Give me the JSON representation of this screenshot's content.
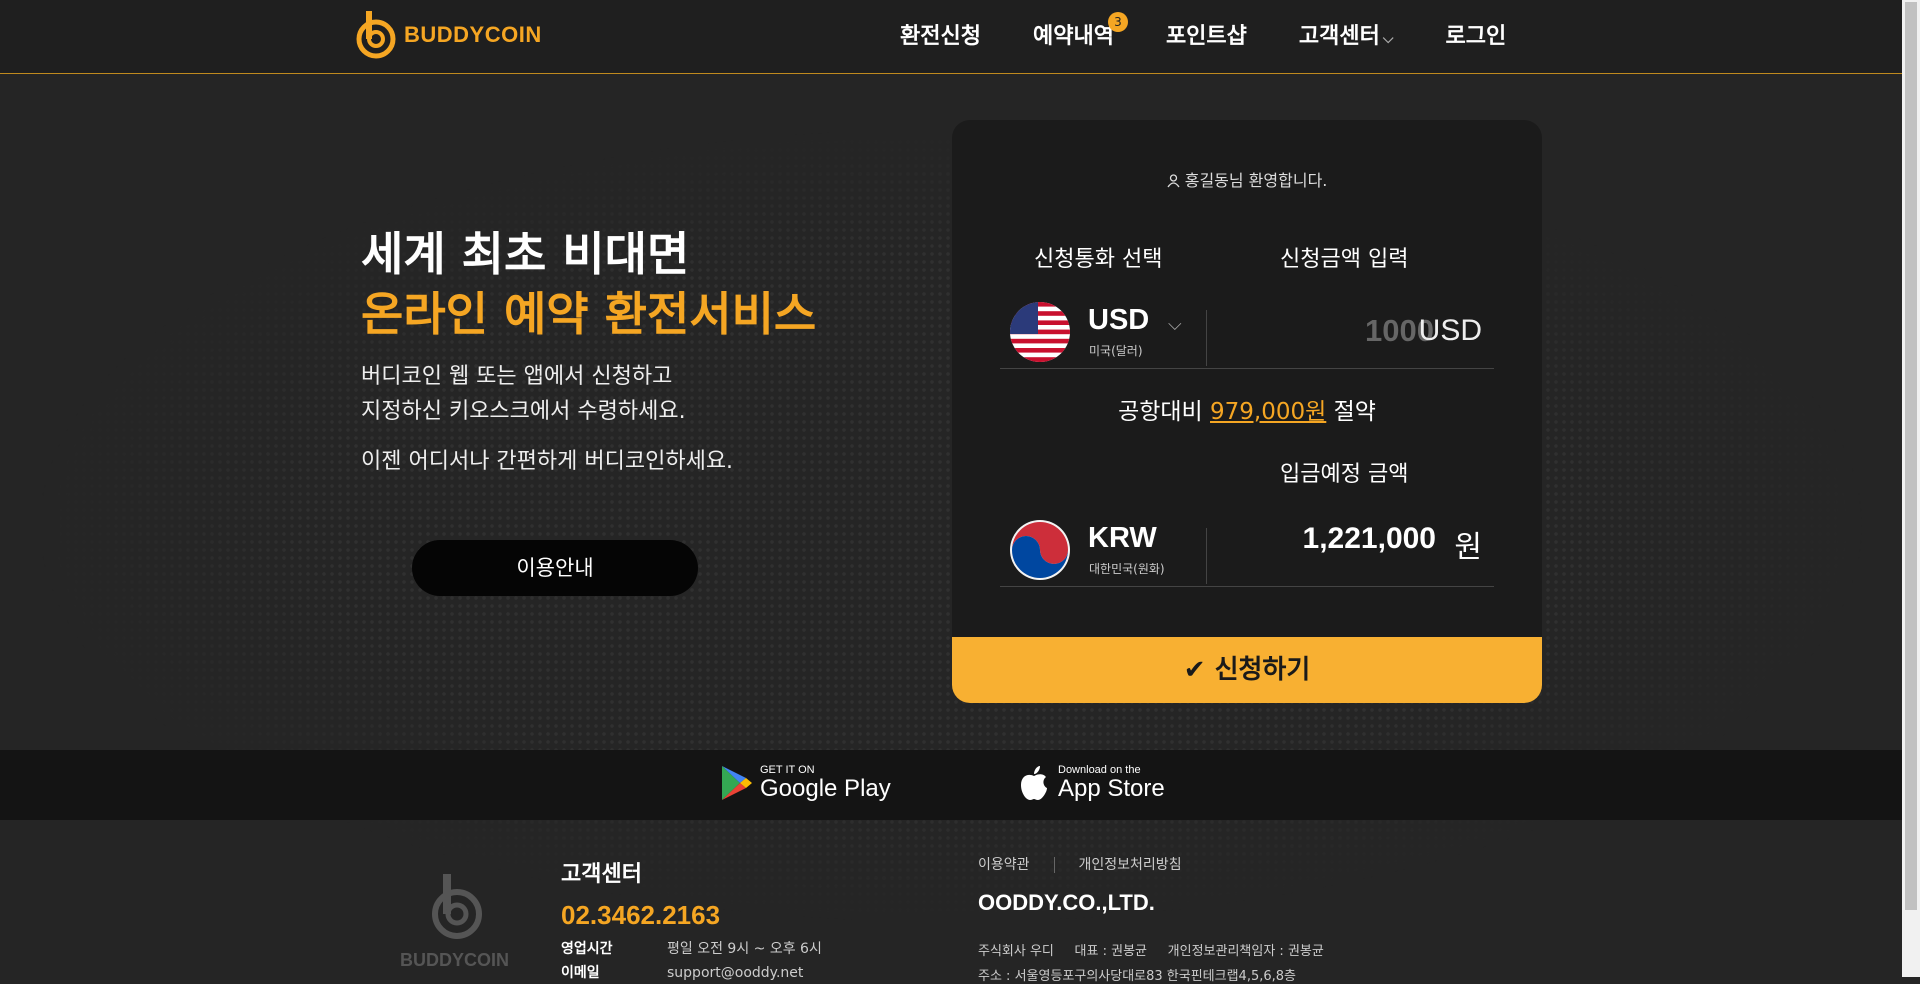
{
  "header": {
    "brand": "BUDDYCOIN",
    "nav": [
      {
        "label": "환전신청"
      },
      {
        "label": "예약내역",
        "badge": "3"
      },
      {
        "label": "포인트샵"
      },
      {
        "label": "고객센터",
        "dropdown": true
      },
      {
        "label": "로그인"
      }
    ]
  },
  "hero": {
    "title_line1": "세계 최초 비대면",
    "title_line2": "온라인 예약 환전서비스",
    "desc_line1": "버디코인 웹 또는 앱에서 신청하고",
    "desc_line2": "지정하신 키오스크에서 수령하세요.",
    "desc_line3": "이젠 어디서나 간편하게 버디코인하세요.",
    "guide_button": "이용안내"
  },
  "form": {
    "welcome": "홍길동님 환영합니다.",
    "currency_select_label": "신청통화 선택",
    "amount_input_label": "신청금액 입력",
    "from_currency": {
      "code": "USD",
      "name": "미국(달러)"
    },
    "amount_placeholder": "1000",
    "amount_unit": "USD",
    "savings_prefix": "공항대비 ",
    "savings_amount": "979,000원",
    "savings_suffix": " 절약",
    "deposit_label": "입금예정 금액",
    "to_currency": {
      "code": "KRW",
      "name": "대한민국(원화)"
    },
    "deposit_amount": "1,221,000",
    "deposit_unit": "원",
    "apply_button": "신청하기"
  },
  "stores": {
    "google_small": "GET IT ON",
    "google_big": "Google Play",
    "apple_small": "Download on the",
    "apple_big": "App Store"
  },
  "footer": {
    "brand": "BUDDYCOIN",
    "cc_title": "고객센터",
    "phone": "02.3462.2163",
    "hours_label": "영업시간",
    "hours_value": "평일 오전 9시 ~ 오후 6시",
    "email_label": "이메일",
    "email_value": "support@ooddy.net",
    "terms_link": "이용약관",
    "privacy_link": "개인정보처리방침",
    "company": "OODDY.CO.,LTD.",
    "company_info": "주식회사 우디     대표 : 권봉균     개인정보관리책임자 : 권봉균",
    "address": "주소 : 서울영등포구의사당대로83 한국핀테크랩4,5,6,8층"
  },
  "colors": {
    "accent": "#f5a623",
    "button": "#f8b032",
    "background": "#252525"
  }
}
